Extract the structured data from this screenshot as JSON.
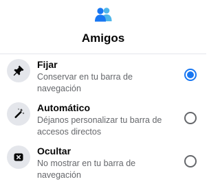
{
  "header": {
    "icon": "friends-icon",
    "title": "Amigos"
  },
  "accent_color": "#1877f2",
  "options": [
    {
      "icon": "pin-icon",
      "title": "Fijar",
      "description": "Conservar en tu barra de navegación",
      "selected": true
    },
    {
      "icon": "magic-wand-icon",
      "title": "Automático",
      "description": "Déjanos personalizar tu barra de accesos directos",
      "selected": false
    },
    {
      "icon": "hide-icon",
      "title": "Ocultar",
      "description": "No mostrar en tu barra de navegación",
      "selected": false
    }
  ]
}
